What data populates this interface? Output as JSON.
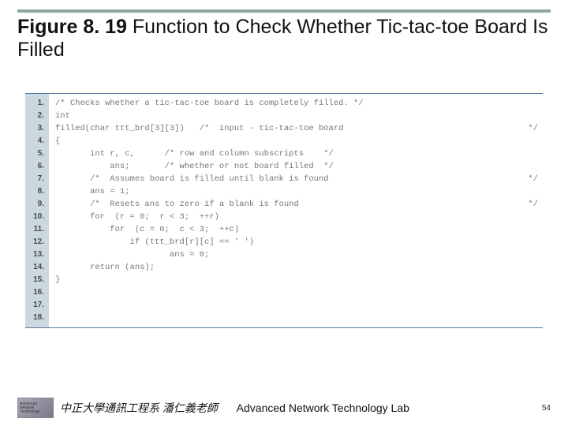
{
  "title": {
    "strong": "Figure 8. 19",
    "rest": "  Function to Check Whether Tic-tac-toe Board Is Filled"
  },
  "code": {
    "lines": [
      {
        "n": "1.",
        "l": "/* Checks whether a tic-tac-toe board is completely filled. */",
        "r": ""
      },
      {
        "n": "2.",
        "l": "int",
        "r": ""
      },
      {
        "n": "3.",
        "l": "filled(char ttt_brd[3][3])   /*  input - tic-tac-toe board",
        "r": "*/"
      },
      {
        "n": "4.",
        "l": "{",
        "r": ""
      },
      {
        "n": "5.",
        "l": "       int r, c,      /* row and column subscripts    */",
        "r": ""
      },
      {
        "n": "6.",
        "l": "           ans;       /* whether or not board filled  */",
        "r": ""
      },
      {
        "n": "7.",
        "l": "",
        "r": ""
      },
      {
        "n": "8.",
        "l": "       /*  Assumes board is filled until blank is found",
        "r": "*/"
      },
      {
        "n": "9.",
        "l": "       ans = 1;",
        "r": ""
      },
      {
        "n": "10.",
        "l": "",
        "r": ""
      },
      {
        "n": "11.",
        "l": "       /*  Resets ans to zero if a blank is found",
        "r": "*/"
      },
      {
        "n": "12.",
        "l": "       for  (r = 0;  r < 3;  ++r)",
        "r": ""
      },
      {
        "n": "13.",
        "l": "           for  (c = 0;  c < 3;  ++c)",
        "r": ""
      },
      {
        "n": "14.",
        "l": "               if (ttt_brd[r][c] == ' ')",
        "r": ""
      },
      {
        "n": "15.",
        "l": "                       ans = 0;",
        "r": ""
      },
      {
        "n": "16.",
        "l": "",
        "r": ""
      },
      {
        "n": "17.",
        "l": "       return (ans);",
        "r": ""
      },
      {
        "n": "18.",
        "l": "}",
        "r": ""
      }
    ]
  },
  "footer": {
    "logo_lines": [
      "Advanced",
      "Network",
      "Technology"
    ],
    "dept": "中正大學通訊工程系 潘仁義老師",
    "lab": "Advanced Network Technology Lab",
    "page": "54"
  }
}
